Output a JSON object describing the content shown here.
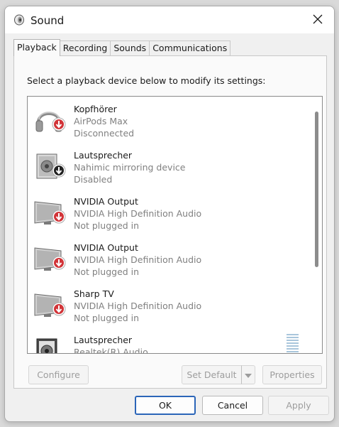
{
  "window": {
    "title": "Sound",
    "app_icon": "speaker-icon",
    "close_icon": "close-icon"
  },
  "tabs": [
    {
      "label": "Playback",
      "active": true
    },
    {
      "label": "Recording",
      "active": false
    },
    {
      "label": "Sounds",
      "active": false
    },
    {
      "label": "Communications",
      "active": false
    }
  ],
  "instruction": "Select a playback device below to modify its settings:",
  "devices": [
    {
      "name": "Kopfhörer",
      "description": "AirPods Max",
      "status": "Disconnected",
      "icon": "headphones-icon",
      "badge": "red-down-arrow-badge"
    },
    {
      "name": "Lautsprecher",
      "description": "Nahimic mirroring device",
      "status": "Disabled",
      "icon": "speaker-box-icon",
      "badge": "black-down-arrow-badge"
    },
    {
      "name": "NVIDIA Output",
      "description": "NVIDIA High Definition Audio",
      "status": "Not plugged in",
      "icon": "monitor-icon",
      "badge": "red-down-arrow-badge"
    },
    {
      "name": "NVIDIA Output",
      "description": "NVIDIA High Definition Audio",
      "status": "Not plugged in",
      "icon": "monitor-icon",
      "badge": "red-down-arrow-badge"
    },
    {
      "name": "Sharp TV",
      "description": "NVIDIA High Definition Audio",
      "status": "Not plugged in",
      "icon": "monitor-icon",
      "badge": "red-down-arrow-badge"
    },
    {
      "name": "Lautsprecher",
      "description": "Realtek(R) Audio",
      "status": "",
      "icon": "speaker-box-dark-icon",
      "badge": ""
    }
  ],
  "buttons": {
    "configure": "Configure",
    "set_default": "Set Default",
    "properties": "Properties",
    "ok": "OK",
    "cancel": "Cancel",
    "apply": "Apply"
  },
  "colors": {
    "accent": "#2b65b8",
    "badge_red": "#d13438"
  }
}
